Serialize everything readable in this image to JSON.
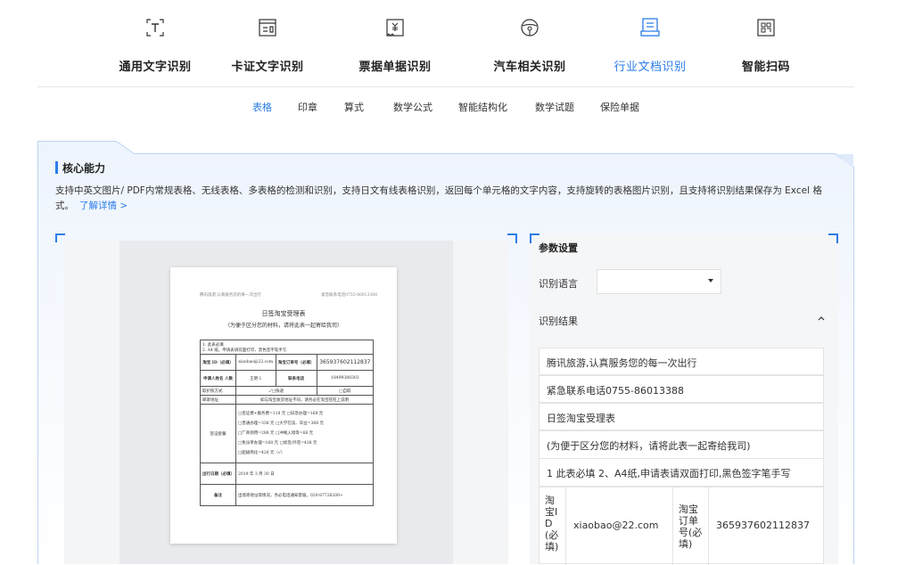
{
  "nav": {
    "items": [
      {
        "label": "通用文字识别",
        "icon": "text-t-icon"
      },
      {
        "label": "卡证文字识别",
        "icon": "id-card-icon"
      },
      {
        "label": "票据单据识别",
        "icon": "receipt-icon"
      },
      {
        "label": "汽车相关识别",
        "icon": "steering-wheel-icon"
      },
      {
        "label": "行业文档识别",
        "icon": "document-icon",
        "active": true
      },
      {
        "label": "智能扫码",
        "icon": "qr-scan-icon"
      }
    ]
  },
  "sub_nav": {
    "items": [
      "表格",
      "印章",
      "算式",
      "数学公式",
      "智能结构化",
      "数学试题",
      "保险单据"
    ],
    "active_index": 0
  },
  "core": {
    "title": "核心能力",
    "description": "支持中英文图片/ PDF内常规表格、无线表格、多表格的检测和识别，支持日文有线表格识别，返回每个单元格的文字内容，支持旋转的表格图片识别，且支持将识别结果保存为 Excel 格式。",
    "learn_more": "了解详情 >"
  },
  "doc_preview": {
    "header_left": "腾讯旅游,认真服务您的每一次出行",
    "header_right": "紧急联系电话0755-86013388",
    "title": "日签淘宝受理表",
    "subtitle": "（为便于区分您的材料，请将此表一起寄给我司）",
    "note1": "1.  此表必填",
    "note2": "2.  A4 纸，申请表请双面打印，黑色签字笔手写",
    "taobao_id_label": "淘宝 ID（必填）",
    "taobao_id": "xiaobao@22.com",
    "order_label": "淘宝订单号（必填）",
    "order_no": "365937602112837",
    "applicant_label": "申请人姓名 人数",
    "applicant": "王明 1",
    "phone_label": "联系电话",
    "phone": "18499388303",
    "return_label": "取护照方式",
    "return_opt1": "✓□快递",
    "return_opt2": "□自取",
    "address_label": "邮寄地址",
    "address": "如与淘宝收货地址不同，请务必在淘宝旺旺上说明",
    "visa_label": "签证套餐",
    "visa_lines": [
      "□签证费+服务费=118 元      □旧急办理=168 元",
      "□普通办理=338 元      □大学在读、毕业=368 元",
      "□厂商领用=288 元      □冲绳入境等=68 元",
      "□免派单办理=168 元      □续签/外签=438 元",
      "□超级简化=428 元（√）"
    ],
    "date_label": "出行日期（必填）",
    "date": "2019 年 3 月 30 日",
    "remark_label": "备注",
    "remark": "出境寄地址等情况，务必电话通知客服，020-87726200~"
  },
  "params": {
    "title": "参数设置",
    "language_label": "识别语言",
    "language_value": "",
    "result_label": "识别结果",
    "result_lines": [
      "腾讯旅游,认真服务您的每一次出行",
      "紧急联系电话0755-86013388",
      "日签淘宝受理表",
      "(为便于区分您的材料，请将此表一起寄给我司)",
      "1 此表必填 2、A4纸,申请表请双面打印,黑色签字笔手写"
    ],
    "grid": {
      "c1": "淘宝ID(必填)",
      "c2": "xiaobao@22.com",
      "c3": "淘宝订单号(必填)",
      "c4": "365937602112837"
    }
  },
  "colors": {
    "accent": "#2b7de9",
    "panel_bg": "#f5f6f8"
  }
}
